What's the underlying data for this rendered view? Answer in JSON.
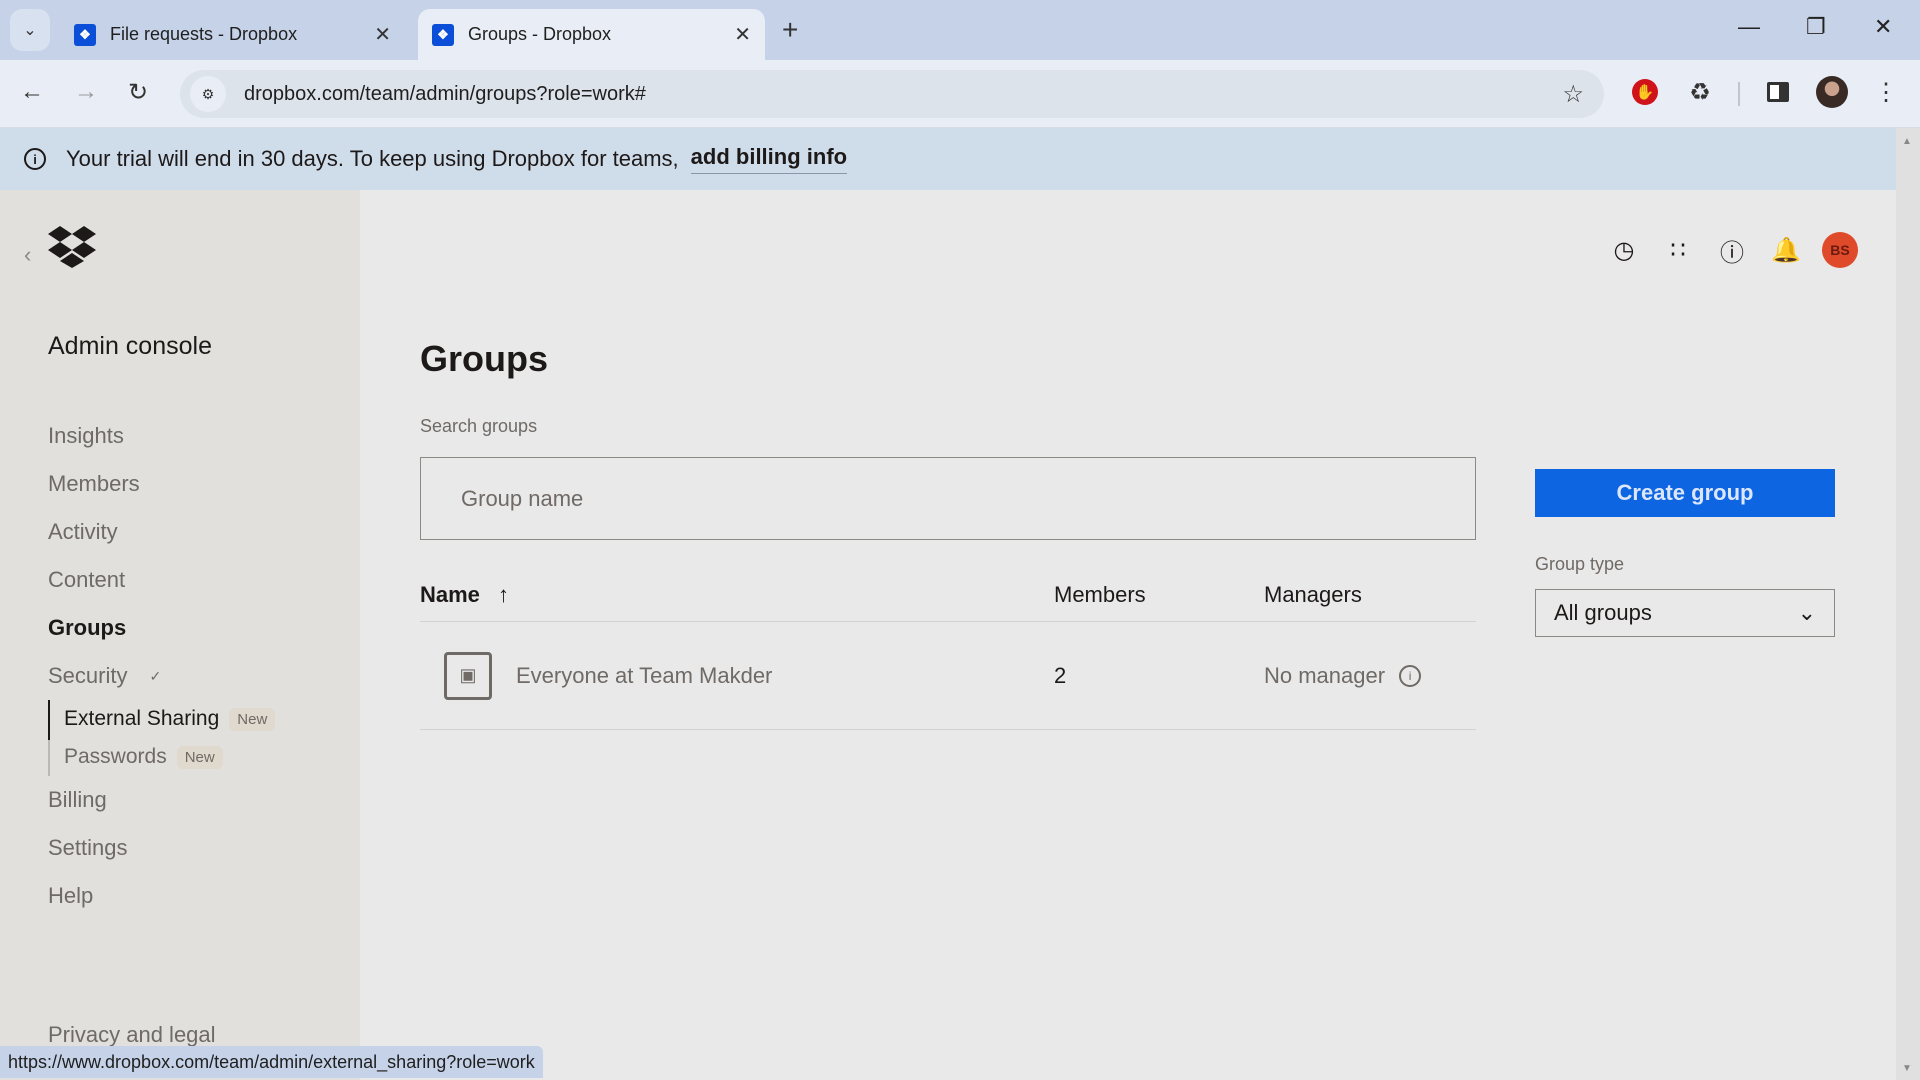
{
  "browser": {
    "tabs": [
      {
        "title": "File requests - Dropbox",
        "active": false
      },
      {
        "title": "Groups - Dropbox",
        "active": true
      }
    ],
    "url": "dropbox.com/team/admin/groups?role=work#",
    "status_url": "https://www.dropbox.com/team/admin/external_sharing?role=work"
  },
  "banner": {
    "text": "Your trial will end in 30 days. To keep using Dropbox for teams,",
    "link": "add billing info"
  },
  "sidebar": {
    "title": "Admin console",
    "items": [
      {
        "label": "Insights"
      },
      {
        "label": "Members"
      },
      {
        "label": "Activity"
      },
      {
        "label": "Content"
      },
      {
        "label": "Groups",
        "active": true
      },
      {
        "label": "Security",
        "expanded": true
      }
    ],
    "security_sub": [
      {
        "label": "External Sharing",
        "badge": "New"
      },
      {
        "label": "Passwords",
        "badge": "New"
      }
    ],
    "items_after": [
      {
        "label": "Billing"
      },
      {
        "label": "Settings"
      },
      {
        "label": "Help"
      }
    ],
    "footer": "Privacy and legal"
  },
  "header": {
    "avatar_initials": "BS",
    "avatar_color": "#df4a2b"
  },
  "main": {
    "title": "Groups",
    "search_label": "Search groups",
    "search_placeholder": "Group name",
    "search_value": "",
    "columns": {
      "name": "Name",
      "members": "Members",
      "managers": "Managers"
    },
    "rows": [
      {
        "name": "Everyone at Team Makder",
        "members": "2",
        "managers": "No manager"
      }
    ],
    "create_button": "Create group",
    "group_type_label": "Group type",
    "group_type_value": "All groups",
    "accent": "#0d65e2"
  }
}
